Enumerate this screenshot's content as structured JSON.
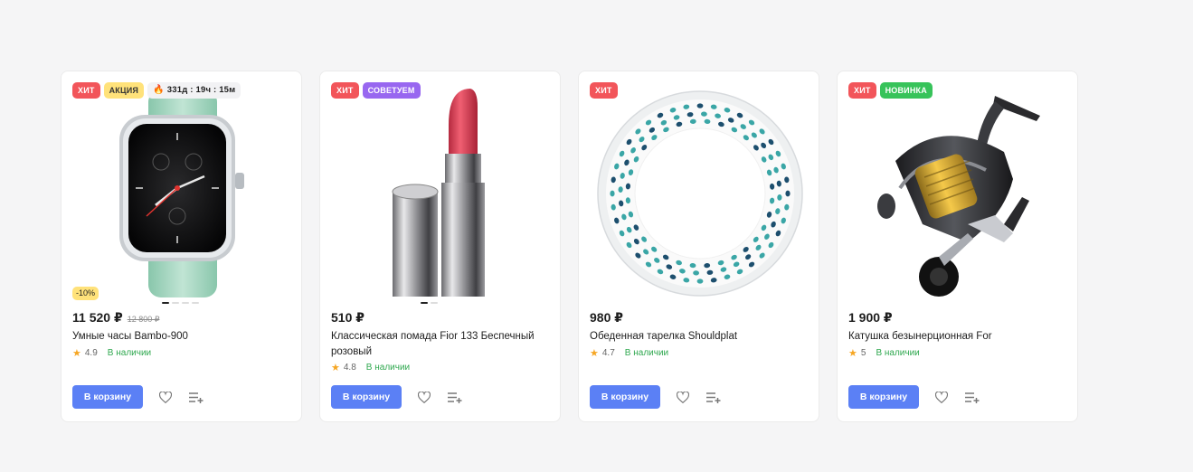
{
  "products": [
    {
      "badges": [
        "ХИТ",
        "АКЦИЯ"
      ],
      "timer": "331д : 19ч : 15м",
      "discount": "-10%",
      "price": "11 520 ₽",
      "old_price": "12 800 ₽",
      "title": "Умные часы Bambo-900",
      "rating": "4.9",
      "stock": "В наличии",
      "cart_label": "В корзину",
      "image": "smartwatch",
      "image_dots": 4
    },
    {
      "badges": [
        "ХИТ",
        "СОВЕТУЕМ"
      ],
      "price": "510 ₽",
      "title": "Классическая помада Fior 133 Беспечный розовый",
      "rating": "4.8",
      "stock": "В наличии",
      "cart_label": "В корзину",
      "image": "lipstick",
      "image_dots": 2
    },
    {
      "badges": [
        "ХИТ"
      ],
      "price": "980 ₽",
      "title": "Обеденная тарелка Shouldplat",
      "rating": "4.7",
      "stock": "В наличии",
      "cart_label": "В корзину",
      "image": "plate"
    },
    {
      "badges": [
        "ХИТ",
        "НОВИНКА"
      ],
      "price": "1 900 ₽",
      "title": "Катушка безынерционная For",
      "rating": "5",
      "stock": "В наличии",
      "cart_label": "В корзину",
      "image": "fishing-reel"
    }
  ],
  "colors": {
    "hit": "#f2555a",
    "sale": "#ffe27a",
    "recommend": "#9867f0",
    "new": "#37c35a",
    "cart_button": "#5b80f5",
    "in_stock": "#2fa84f",
    "star": "#f6a623"
  },
  "icons": [
    "flame-icon",
    "star-icon",
    "heart-icon",
    "compare-icon"
  ]
}
